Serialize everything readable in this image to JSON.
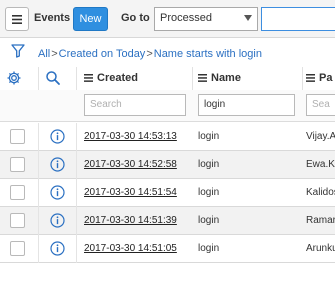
{
  "header": {
    "app_title": "Events",
    "new_label": "New",
    "goto_label": "Go to",
    "goto_selected": "Processed",
    "goto_input_value": ""
  },
  "breadcrumb": {
    "items": [
      "All",
      "Created on Today",
      "Name starts with login"
    ],
    "separator": ">"
  },
  "table": {
    "columns": {
      "created": "Created",
      "name": "Name",
      "part": "Pa"
    },
    "filters": {
      "created_placeholder": "Search",
      "name_value": "login",
      "part_placeholder": "Sea"
    },
    "rows": [
      {
        "created": "2017-03-30 14:53:13",
        "name": "login",
        "part": "Vijay.A"
      },
      {
        "created": "2017-03-30 14:52:58",
        "name": "login",
        "part": "Ewa.K"
      },
      {
        "created": "2017-03-30 14:51:54",
        "name": "login",
        "part": "Kalidos"
      },
      {
        "created": "2017-03-30 14:51:39",
        "name": "login",
        "part": "Ramar"
      },
      {
        "created": "2017-03-30 14:51:05",
        "name": "login",
        "part": "Arunku"
      }
    ]
  },
  "colors": {
    "accent": "#2f8fe0",
    "link": "#2b70c2",
    "row_alt": "#f2f2f2"
  },
  "icons": [
    "hamburger-icon",
    "filter-icon",
    "gear-icon",
    "search-icon",
    "info-icon",
    "list-icon"
  ]
}
